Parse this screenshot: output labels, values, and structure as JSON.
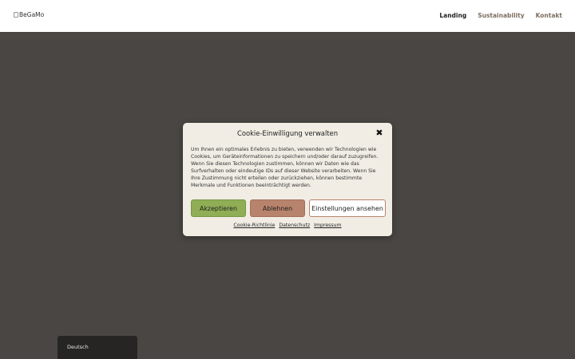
{
  "header": {
    "logo_alt": "BeGaMo",
    "nav": [
      {
        "label": "Landing",
        "active": true
      },
      {
        "label": "Sustainability",
        "active": false
      },
      {
        "label": "Kontakt",
        "active": false
      }
    ]
  },
  "cookie_dialog": {
    "title": "Cookie-Einwilligung verwalten",
    "close_icon": "close-icon",
    "body": "Um Ihnen ein optimales Erlebnis zu bieten, verwenden wir Technologien wie Cookies, um Geräteinformationen zu speichern und/oder darauf zuzugreifen. Wenn Sie diesen Technologien zustimmen, können wir Daten wie das Surfverhalten oder eindeutige IDs auf dieser Website verarbeiten. Wenn Sie Ihre Zustimmung nicht erteilen oder zurückziehen, können bestimmte Merkmale und Funktionen beeinträchtigt werden.",
    "accept_label": "Akzeptieren",
    "deny_label": "Ablehnen",
    "settings_label": "Einstellungen ansehen",
    "links": [
      "Cookie-Richtlinie",
      "Datenschutz",
      "Impressum"
    ]
  },
  "language_switcher": {
    "label": "Deutsch"
  },
  "colors": {
    "backdrop": "#4a4643",
    "dialog_bg": "#f1ede4",
    "accept": "#8fae55",
    "deny": "#b8836c",
    "nav_inactive": "#7d6e5e"
  }
}
